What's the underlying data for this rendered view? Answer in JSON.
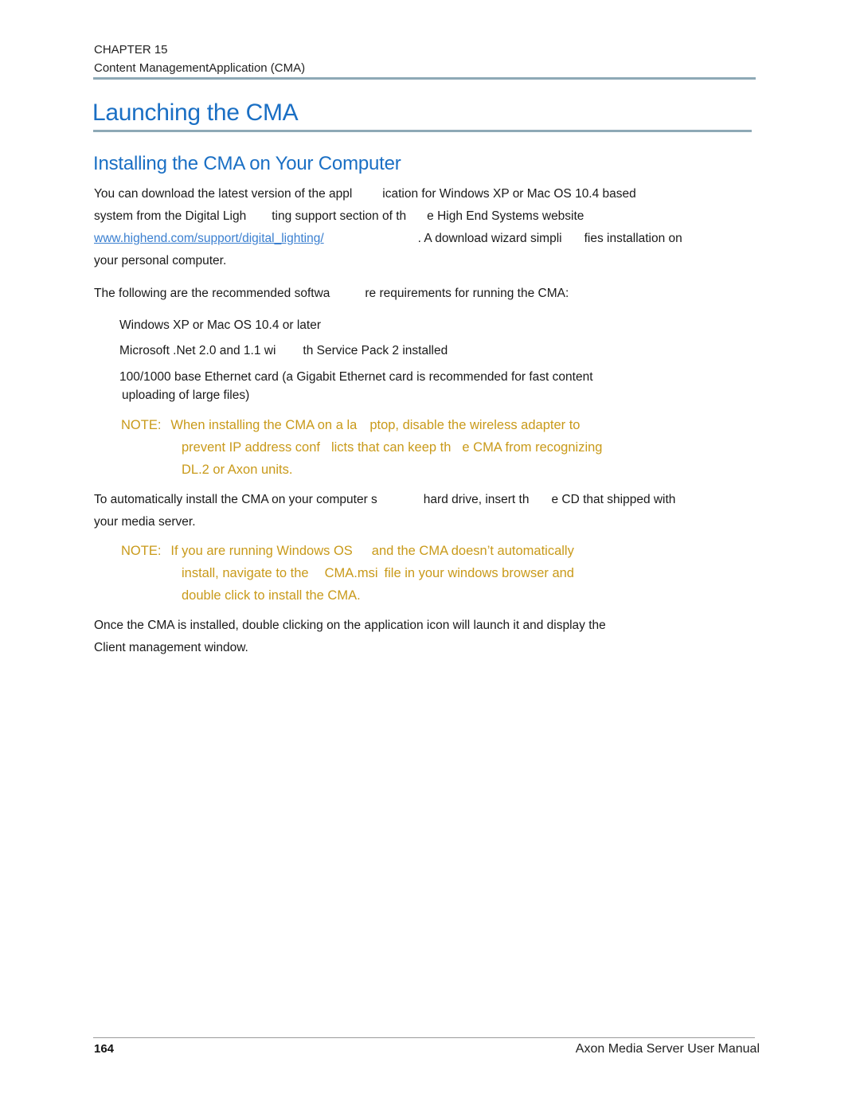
{
  "header": {
    "chapter": "CHAPTER 15",
    "chapter_title": "Content ManagementApplication (CMA)"
  },
  "section": {
    "title": "Launching the CMA",
    "subtitle": "Installing the CMA on Your Computer"
  },
  "intro": {
    "line1a": "You can download the latest version of the appl",
    "line1b": "ication for Windows XP or Mac OS 10.4 based",
    "line2a": "system from the Digital Ligh",
    "line2b": "ting support section of th",
    "line2c": "e High End Systems website",
    "link": "www.highend.com/support/digital_lighting/",
    "line3a": ". A download wizard simpli",
    "line3b": "fies installation on",
    "line4": "your personal computer."
  },
  "requirements": {
    "lead_a": "The following are the recommended softwa",
    "lead_b": "re requirements for running the CMA:",
    "items": [
      {
        "text_a": "Windows XP or Mac OS 10.4 or later"
      },
      {
        "text_a": "Microsoft .Net 2.0 and 1.1 wi",
        "text_b": "th Service Pack 2 installed"
      },
      {
        "text_a": "100/1000 base Ethernet card (a Gigabit Ethernet card is recommended for fast content",
        "text_cont": "uploading of large files)"
      }
    ]
  },
  "note1": {
    "label": "NOTE:",
    "line1a": "When installing the CMA on a la",
    "line1b": "ptop, disable the wireless adapter to",
    "line2a": "prevent IP address conf",
    "line2b": "licts that can keep th",
    "line2c": "e CMA from recognizing",
    "line3": "DL.2 or Axon units."
  },
  "auto_install": {
    "line1a": "To automatically install the CMA on your computer s",
    "line1b": "hard drive, insert th",
    "line1c": "e CD that shipped with",
    "line2": "your media server."
  },
  "note2": {
    "label": "NOTE:",
    "line1a": "If you are running Windows OS",
    "line1b": "and the CMA doesn’t automatically",
    "line2a": "install, navigate to the",
    "line2b": "CMA.msi",
    "line2c": "file in your windows browser and",
    "line3": "double click to install the CMA."
  },
  "closing": {
    "line1": "Once the CMA is installed, double clicking on the application icon will launch it and display the",
    "line2": "Client management window."
  },
  "footer": {
    "page_number": "164",
    "manual_title": "Axon Media Server User Manual"
  },
  "colors": {
    "heading": "#1a6fc4",
    "note": "#c99a1a",
    "link": "#3a7fd0",
    "rule": "#8ea9b6"
  }
}
